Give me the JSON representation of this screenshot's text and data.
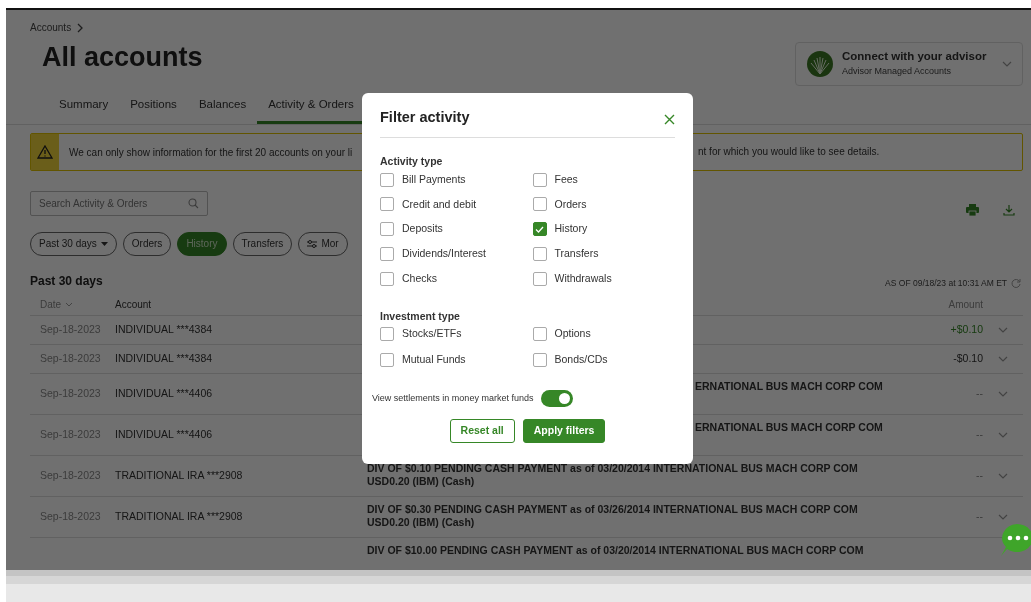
{
  "breadcrumb": {
    "label": "Accounts"
  },
  "page_title": "All accounts",
  "advisor_card": {
    "title": "Connect with your advisor",
    "subtitle": "Advisor Managed Accounts"
  },
  "tabs": [
    {
      "label": "Summary",
      "selected": false
    },
    {
      "label": "Positions",
      "selected": false
    },
    {
      "label": "Balances",
      "selected": false
    },
    {
      "label": "Activity & Orders",
      "selected": true
    }
  ],
  "banner": {
    "text_parts": [
      "We can only show information for the first 20 accounts on your li",
      "nt for which you would like to see details."
    ]
  },
  "search": {
    "placeholder": "Search Activity & Orders"
  },
  "chips": [
    {
      "label": "Past 30 days",
      "kind": "dropdown",
      "selected": false
    },
    {
      "label": "Orders",
      "kind": "plain",
      "selected": false
    },
    {
      "label": "History",
      "kind": "plain",
      "selected": true
    },
    {
      "label": "Transfers",
      "kind": "plain",
      "selected": false
    },
    {
      "label": "Mor",
      "kind": "more",
      "selected": false
    }
  ],
  "section_title": "Past 30 days",
  "as_of": "AS OF 09/18/23 at 10:31 AM ET",
  "table": {
    "columns": [
      {
        "label": "Date",
        "sortable": true
      },
      {
        "label": "Account",
        "sortable": false
      },
      {
        "label": "Amount",
        "sortable": false
      }
    ],
    "rows": [
      {
        "date": "Sep-18-2023",
        "account": "INDIVIDUAL ***4384",
        "amount": "+$0.10",
        "positive": true
      },
      {
        "date": "Sep-18-2023",
        "account": "INDIVIDUAL ***4384",
        "amount": "-$0.10",
        "positive": false
      },
      {
        "date": "Sep-18-2023",
        "account": "INDIVIDUAL ***4406",
        "description_tail": "ERNATIONAL BUS MACH CORP COM",
        "amount": "--",
        "positive": false
      },
      {
        "date": "Sep-18-2023",
        "account": "INDIVIDUAL ***4406",
        "description_tail": "ERNATIONAL BUS MACH CORP COM",
        "amount": "--",
        "positive": false
      },
      {
        "date": "Sep-18-2023",
        "account": "TRADITIONAL IRA ***2908",
        "description": [
          "DIV OF $0.10 PENDING CASH PAYMENT as of 03/20/2014 INTERNATIONAL BUS MACH CORP COM",
          "USD0.20 (IBM) (Cash)"
        ],
        "amount": "--",
        "positive": false
      },
      {
        "date": "Sep-18-2023",
        "account": "TRADITIONAL IRA ***2908",
        "description": [
          "DIV OF $0.30 PENDING CASH PAYMENT as of 03/26/2014 INTERNATIONAL BUS MACH CORP COM",
          "USD0.20 (IBM) (Cash)"
        ],
        "amount": "--",
        "positive": false
      },
      {
        "description": [
          "DIV OF $10.00 PENDING CASH PAYMENT as of 03/20/2014 INTERNATIONAL BUS MACH CORP COM"
        ]
      }
    ]
  },
  "filter_dialog": {
    "title": "Filter activity",
    "sections": [
      {
        "title": "Activity type",
        "options": [
          {
            "label": "Bill Payments",
            "checked": false
          },
          {
            "label": "Credit and debit",
            "checked": false
          },
          {
            "label": "Deposits",
            "checked": false
          },
          {
            "label": "Dividends/Interest",
            "checked": false
          },
          {
            "label": "Checks",
            "checked": false
          },
          {
            "label": "Fees",
            "checked": false
          },
          {
            "label": "Orders",
            "checked": false
          },
          {
            "label": "History",
            "checked": true
          },
          {
            "label": "Transfers",
            "checked": false
          },
          {
            "label": "Withdrawals",
            "checked": false
          }
        ]
      },
      {
        "title": "Investment type",
        "options": [
          {
            "label": "Stocks/ETFs",
            "checked": false
          },
          {
            "label": "Mutual Funds",
            "checked": false
          },
          {
            "label": "Options",
            "checked": false
          },
          {
            "label": "Bonds/CDs",
            "checked": false
          }
        ]
      }
    ],
    "toggle": {
      "label": "View settlements in money market funds",
      "on": true
    },
    "buttons": [
      {
        "label": "Reset all",
        "kind": "outline"
      },
      {
        "label": "Apply filters",
        "kind": "primary"
      }
    ]
  }
}
